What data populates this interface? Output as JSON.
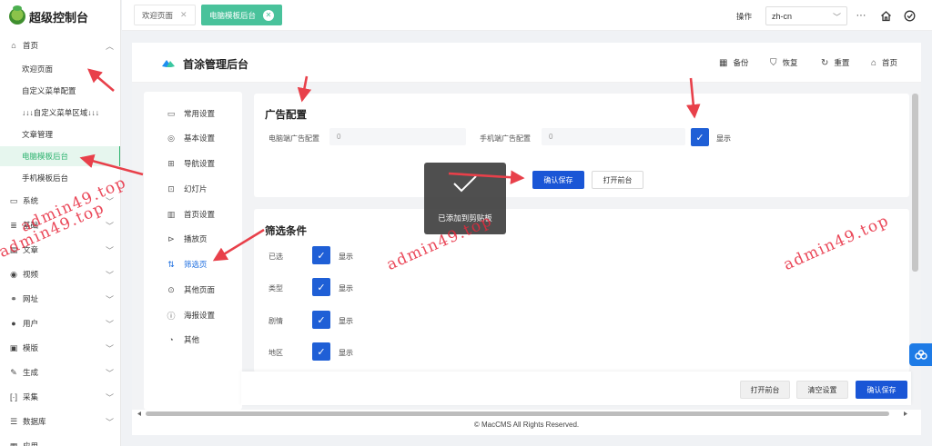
{
  "sidebar": {
    "logo_text": "超级控制台",
    "home": "首页",
    "home_children": [
      "欢迎页面",
      "自定义菜单配置",
      "↓↓↓自定义菜单区域↓↓↓",
      "文章管理",
      "电脑模板后台",
      "手机模板后台"
    ],
    "active_child": "电脑模板后台",
    "groups": [
      "系统",
      "基础",
      "文章",
      "视频",
      "网址",
      "用户",
      "模版",
      "生成",
      "采集",
      "数据库",
      "应用"
    ]
  },
  "topbar": {
    "tabs": [
      {
        "label": "欢迎页面",
        "active": false
      },
      {
        "label": "电脑模板后台",
        "active": true
      }
    ],
    "op_label": "操作",
    "lang": "zh-cn",
    "more": "···"
  },
  "header": {
    "title": "首涂管理后台",
    "buttons": [
      "备份",
      "恢复",
      "重置",
      "首页"
    ]
  },
  "settings_menu": [
    "常用设置",
    "基本设置",
    "导航设置",
    "幻灯片",
    "首页设置",
    "播放页",
    "筛选页",
    "其他页面",
    "海报设置",
    "其他"
  ],
  "settings_menu_active": "筛选页",
  "ad_card": {
    "title": "广告配置",
    "pc_label": "电脑端广告配置",
    "pc_value": "0",
    "mobile_label": "手机端广告配置",
    "mobile_value": "0",
    "show_label": "显示",
    "save_btn": "确认保存",
    "open_btn": "打开前台"
  },
  "filter_card": {
    "title": "筛选条件",
    "rows": [
      {
        "label": "已选",
        "show": "显示"
      },
      {
        "label": "类型",
        "show": "显示"
      },
      {
        "label": "剧情",
        "show": "显示"
      },
      {
        "label": "地区",
        "show": "显示"
      }
    ]
  },
  "toast": "已添加到剪贴板",
  "bottom_bar": {
    "open_btn": "打开前台",
    "clear_btn": "清空设置",
    "save_btn": "确认保存"
  },
  "copyright": "© MacCMS All Rights Reserved.",
  "watermark": "admin49.top",
  "colors": {
    "accent_green": "#49c29b",
    "primary_blue": "#1a56d6",
    "arrow_red": "#e8404a"
  }
}
